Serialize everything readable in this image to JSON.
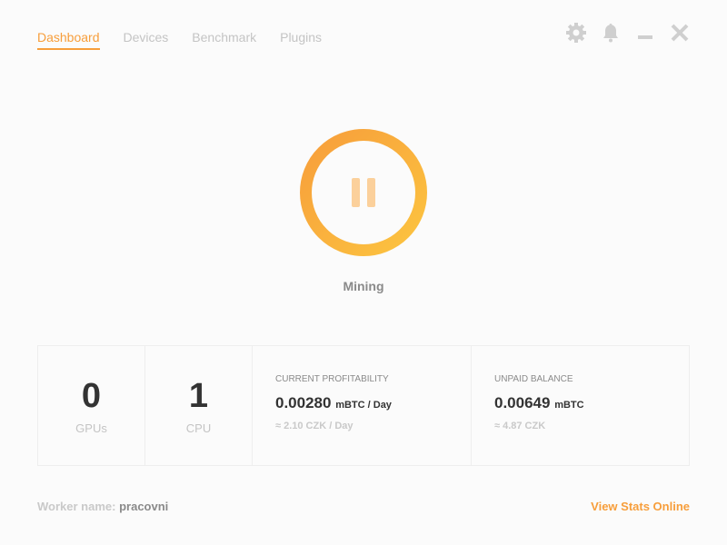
{
  "nav": {
    "tabs": [
      {
        "label": "Dashboard"
      },
      {
        "label": "Devices"
      },
      {
        "label": "Benchmark"
      },
      {
        "label": "Plugins"
      }
    ]
  },
  "window_controls": [
    "gear-icon",
    "bell-icon",
    "minimize-icon",
    "close-icon"
  ],
  "colors": {
    "accent": "#f79e3b",
    "ring_start": "#f79e3b",
    "ring_end": "#fcc440",
    "pause": "#fbd09b"
  },
  "mining": {
    "status": "Mining"
  },
  "stats": {
    "gpus": {
      "count": "0",
      "label": "GPUs"
    },
    "cpu": {
      "count": "1",
      "label": "CPU"
    },
    "profitability": {
      "title": "CURRENT PROFITABILITY",
      "value": "0.00280",
      "unit": "mBTC / Day",
      "fiat": "≈ 2.10 CZK / Day"
    },
    "balance": {
      "title": "UNPAID BALANCE",
      "value": "0.00649",
      "unit": "mBTC",
      "fiat": "≈ 4.87 CZK"
    }
  },
  "footer": {
    "worker_label": "Worker name:",
    "worker_name": "pracovni",
    "link": "View Stats Online"
  }
}
